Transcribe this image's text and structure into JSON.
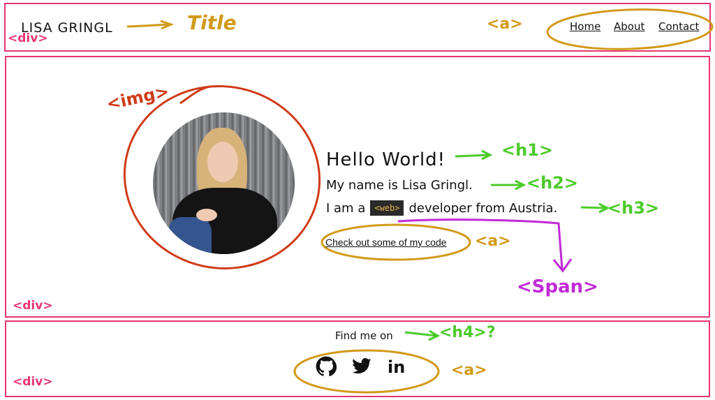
{
  "header": {
    "title": "LISA GRINGL",
    "nav": [
      {
        "label": "Home"
      },
      {
        "label": "About"
      },
      {
        "label": "Contact"
      }
    ]
  },
  "hero": {
    "h1": "Hello World!",
    "h2": "My name is Lisa Gringl.",
    "h3_prefix": "I am a",
    "h3_code": "<web>",
    "h3_suffix": "developer from Austria.",
    "link": "Check out some of my code"
  },
  "footer": {
    "find_me": "Find me on",
    "social_icons": [
      "github-icon",
      "twitter-icon",
      "linkedin-icon"
    ],
    "linkedin_text": "in"
  },
  "annotations": {
    "div_label": "<div>",
    "title_label": "Title",
    "a_label": "<a>",
    "img_label": "<img>",
    "h1_label": "<h1>",
    "h2_label": "<h2>",
    "h3_label": "<h3>",
    "span_label": "<Span>",
    "h4_label": "<h4>?"
  },
  "colors": {
    "box_outline": "#e8356f",
    "gold_annotation": "#d29a1a",
    "green_annotation": "#4ccb2a",
    "red_annotation": "#cf3b18",
    "magenta_annotation": "#c02ad6",
    "code_bg": "#2a2a2a",
    "code_text": "#e6b84c"
  }
}
